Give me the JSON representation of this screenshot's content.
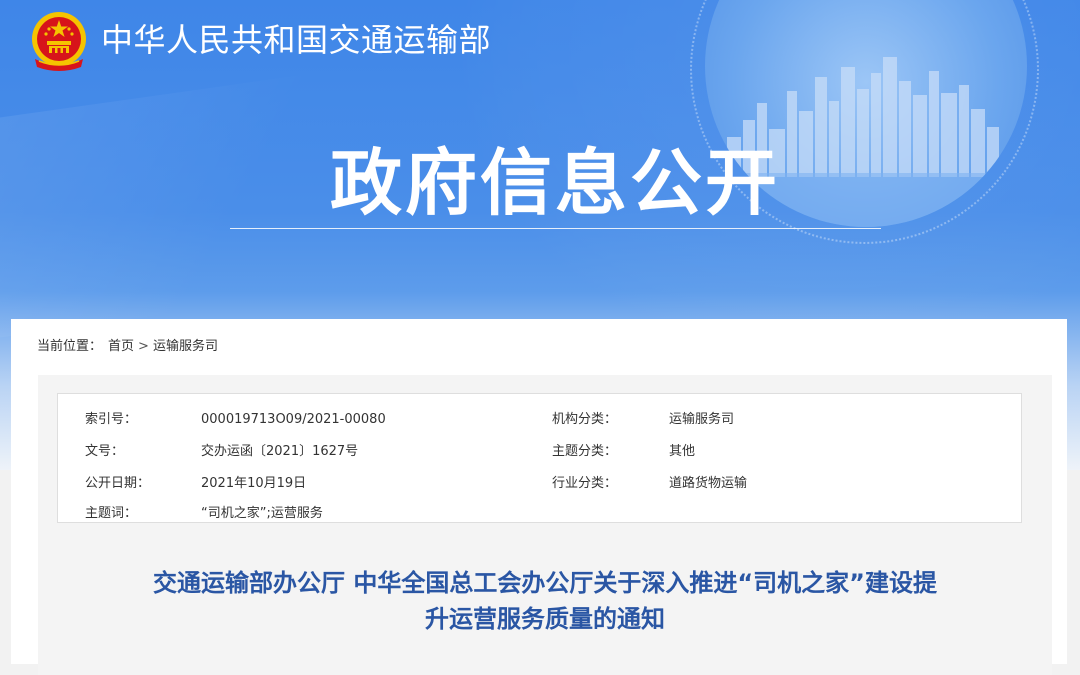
{
  "header": {
    "site_name": "中华人民共和国交通运输部",
    "section_title": "政府信息公开"
  },
  "breadcrumb": {
    "label": "当前位置：",
    "items": [
      "首页",
      "运输服务司"
    ],
    "separator": ">"
  },
  "meta": {
    "index_no_label": "索引号：",
    "index_no_value": "000019713O09/2021-00080",
    "org_label": "机构分类：",
    "org_value": "运输服务司",
    "doc_no_label": "文号：",
    "doc_no_value": "交办运函〔2021〕1627号",
    "topic_label": "主题分类：",
    "topic_value": "其他",
    "date_label": "公开日期：",
    "date_value": "2021年10月19日",
    "industry_label": "行业分类：",
    "industry_value": "道路货物运输",
    "keywords_label": "主题词：",
    "keywords_value": "“司机之家”;运营服务"
  },
  "document": {
    "title_line1": "交通运输部办公厅 中华全国总工会办公厅关于深入推进“司机之家”建设提",
    "title_line2": "升运营服务质量的通知"
  },
  "colors": {
    "banner_blue": "#4a8ee9",
    "title_blue": "#2a56a4",
    "emblem_red": "#d7141a",
    "emblem_gold": "#f5c400"
  },
  "icons": {
    "emblem": "national-emblem-icon"
  }
}
